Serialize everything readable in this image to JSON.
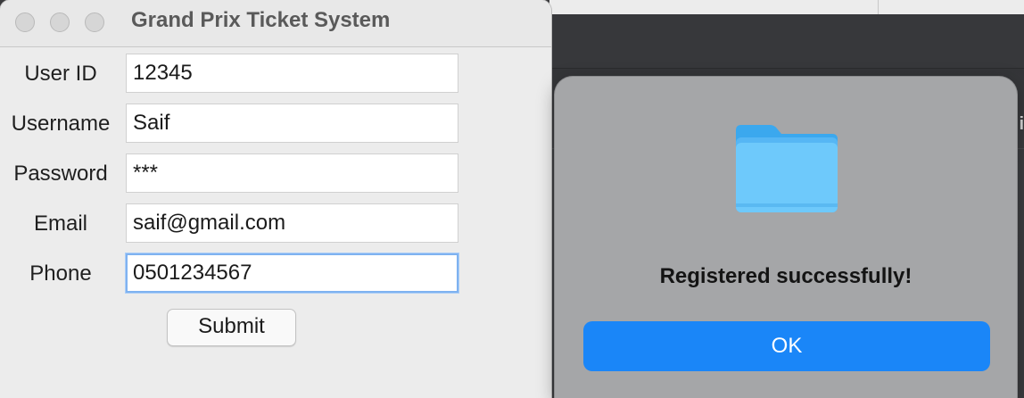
{
  "window": {
    "title": "Grand Prix Ticket System"
  },
  "form": {
    "fields": [
      {
        "label": "User ID",
        "value": "12345"
      },
      {
        "label": "Username",
        "value": "Saif"
      },
      {
        "label": "Password",
        "value": "***"
      },
      {
        "label": "Email",
        "value": "saif@gmail.com"
      },
      {
        "label": "Phone",
        "value": "0501234567"
      }
    ],
    "submit_label": "Submit"
  },
  "dialog": {
    "icon": "folder-icon",
    "message": "Registered successfully!",
    "ok_label": "OK"
  },
  "background": {
    "edge_char": "i"
  },
  "colors": {
    "ok_button": "#1a86f8",
    "focus_ring": "#7fb2f0",
    "folder": "#6ec9fb"
  }
}
